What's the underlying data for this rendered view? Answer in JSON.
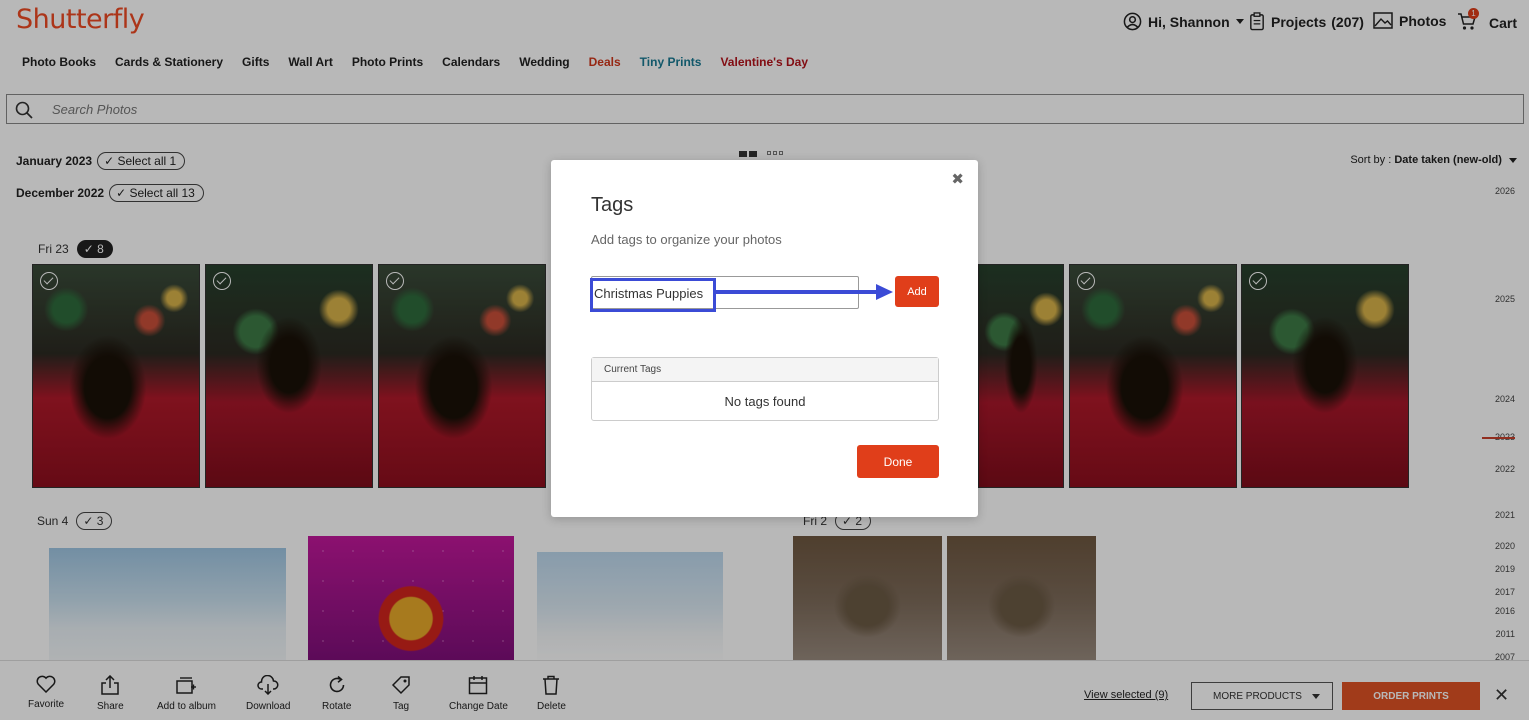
{
  "header": {
    "logo": "Shutterfly",
    "greeting": "Hi, Shannon",
    "projects_label": "Projects",
    "projects_count": "(207)",
    "photos_label": "Photos",
    "cart_label": "Cart",
    "cart_badge": "1"
  },
  "nav": {
    "items": [
      "Photo Books",
      "Cards & Stationery",
      "Gifts",
      "Wall Art",
      "Photo Prints",
      "Calendars",
      "Wedding",
      "Deals",
      "Tiny Prints",
      "Valentine's Day"
    ]
  },
  "search": {
    "placeholder": "Search Photos"
  },
  "groups": {
    "jan": {
      "label": "January 2023",
      "select": "Select all 1"
    },
    "dec": {
      "label": "December 2022",
      "select": "Select all 13"
    },
    "fri23": {
      "label": "Fri 23",
      "count": "8"
    },
    "sun4": {
      "label": "Sun 4",
      "count": "3"
    },
    "fri2": {
      "label": "Fri 2",
      "count": "2"
    }
  },
  "sort": {
    "prefix": "Sort by : ",
    "value": "Date taken (new-old)"
  },
  "timeline": [
    "2026",
    "2025",
    "2024",
    "2023",
    "2022",
    "2021",
    "2020",
    "2019",
    "2017",
    "2016",
    "2011",
    "2007"
  ],
  "modal": {
    "title": "Tags",
    "subtitle": "Add tags to organize your photos",
    "input_value": "Christmas Puppies",
    "add_label": "Add",
    "current_tags_header": "Current Tags",
    "empty_message": "No tags found",
    "done_label": "Done",
    "annotation_color": "#3b4bd6"
  },
  "toolbar": {
    "favorite": "Favorite",
    "share": "Share",
    "add_to_album": "Add to album",
    "download": "Download",
    "rotate": "Rotate",
    "tag": "Tag",
    "change_date": "Change Date",
    "delete": "Delete",
    "view_selected": "View selected (9)",
    "more_products": "MORE PRODUCTS",
    "order_prints": "ORDER PRINTS"
  },
  "colors": {
    "brand": "#ef4a23",
    "primary_button": "#e03e1a"
  }
}
